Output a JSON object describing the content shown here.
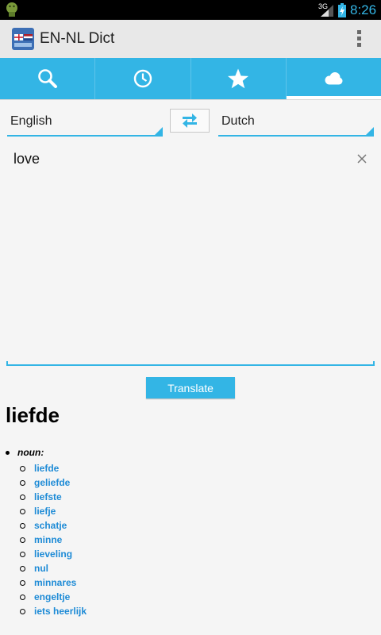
{
  "status_bar": {
    "network": "3G",
    "time": "8:26"
  },
  "action_bar": {
    "title": "EN-NL Dict",
    "icon": "app-flags-icon"
  },
  "tabs": [
    {
      "icon": "search-icon",
      "selected": false
    },
    {
      "icon": "history-clock-icon",
      "selected": false
    },
    {
      "icon": "star-icon",
      "selected": false
    },
    {
      "icon": "cloud-icon",
      "selected": true
    }
  ],
  "languages": {
    "source": "English",
    "target": "Dutch"
  },
  "input": {
    "text": "love"
  },
  "translate_label": "Translate",
  "result": {
    "word": "liefde",
    "part_of_speech": "noun:",
    "translations": [
      "liefde",
      "geliefde",
      "liefste",
      "liefje",
      "schatje",
      "minne",
      "lieveling",
      "nul",
      "minnares",
      "engeltje",
      "iets heerlijk"
    ]
  },
  "colors": {
    "accent": "#33b5e5",
    "link": "#1e8bd6"
  }
}
